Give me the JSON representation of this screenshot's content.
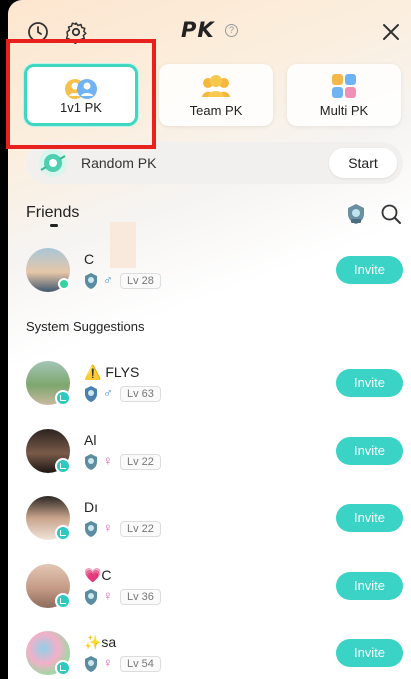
{
  "header": {
    "title": "PK",
    "help_symbol": "?",
    "icons": [
      "history-icon",
      "settings-icon",
      "close-icon"
    ]
  },
  "modes": [
    {
      "label": "1v1 PK",
      "selected": true
    },
    {
      "label": "Team PK",
      "selected": false
    },
    {
      "label": "Multi PK",
      "selected": false
    }
  ],
  "random": {
    "label": "Random PK",
    "button": "Start"
  },
  "friends": {
    "title": "Friends",
    "items": [
      {
        "name": "C",
        "gender": "♂",
        "level": "Lv 28",
        "action": "Invite"
      }
    ]
  },
  "suggestions": {
    "title": "System Suggestions",
    "items": [
      {
        "name": "⚠️ FLYS",
        "gender": "♂",
        "level": "Lv 63",
        "action": "Invite"
      },
      {
        "name": "Al",
        "gender": "♀",
        "level": "Lv 22",
        "action": "Invite"
      },
      {
        "name": "Dı",
        "gender": "♀",
        "level": "Lv 22",
        "action": "Invite"
      },
      {
        "name": "💗C",
        "gender": "♀",
        "level": "Lv 36",
        "action": "Invite"
      },
      {
        "name": "✨sa",
        "gender": "♀",
        "level": "Lv 54",
        "action": "Invite"
      }
    ]
  },
  "colors": {
    "accent": "#3ad3c6",
    "highlight": "#e8201e",
    "male": "#3a8bd8",
    "female": "#e060a8"
  }
}
